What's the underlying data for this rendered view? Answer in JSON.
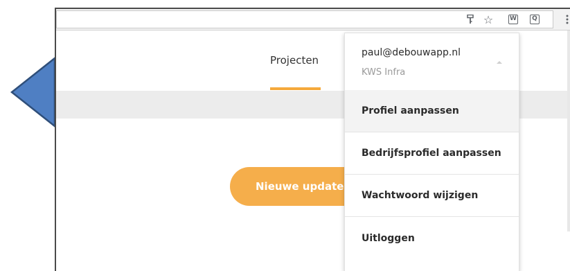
{
  "browser": {
    "toolbar_icons": [
      "key-icon",
      "star-icon",
      "extension-icon",
      "extension-icon",
      "menu-icon"
    ],
    "star_glyph": "☆",
    "ext1_glyph": "W",
    "ext2_glyph": "Q"
  },
  "app": {
    "nav": {
      "projects_label": "Projecten",
      "active_color": "#f5a93b"
    },
    "update_button_label": "Nieuwe updates",
    "accent_color": "#f5ae4b"
  },
  "dropdown": {
    "email": "paul@debouwapp.nl",
    "company": "KWS Infra",
    "items": [
      {
        "label": "Profiel aanpassen"
      },
      {
        "label": "Bedrijfsprofiel aanpassen"
      },
      {
        "label": "Wachtwoord wijzigen"
      },
      {
        "label": "Uitloggen"
      }
    ]
  },
  "callout": {
    "color": "#4f7fc3",
    "border_color": "#2f4f7a"
  }
}
